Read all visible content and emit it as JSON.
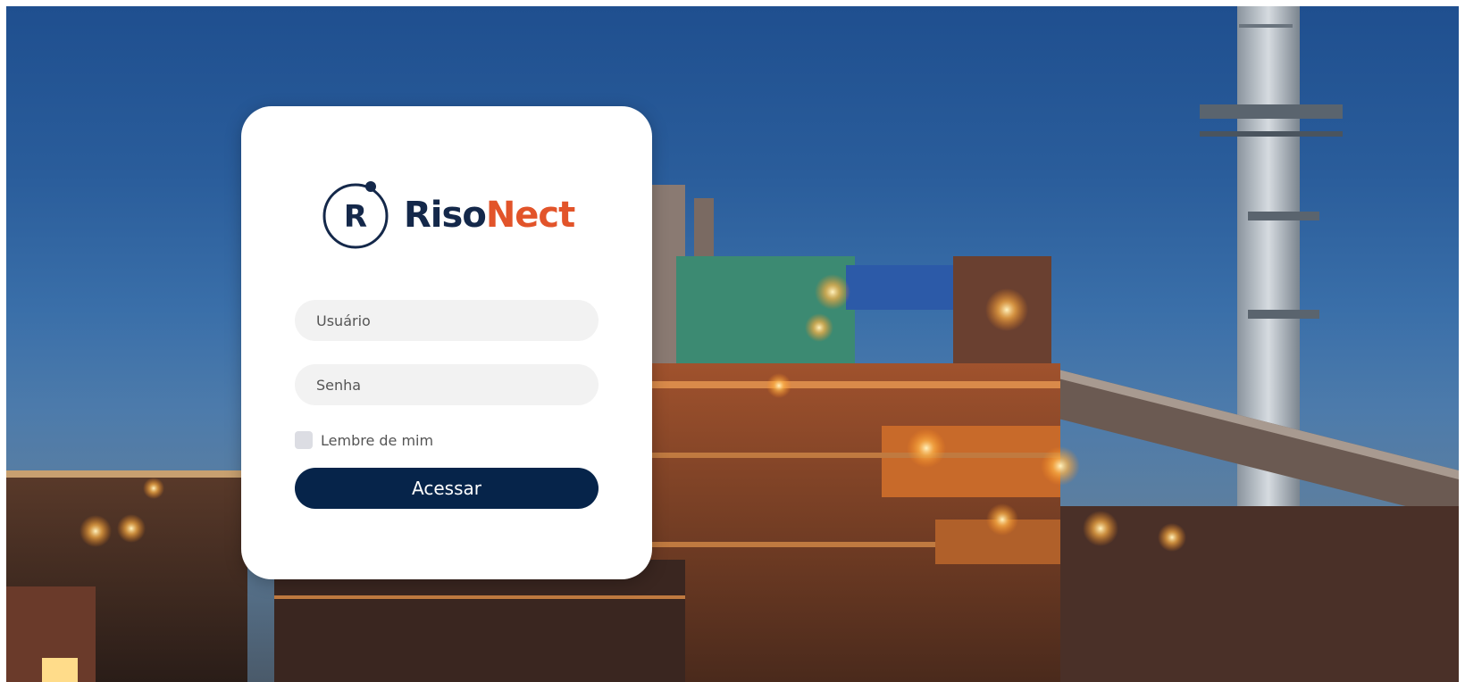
{
  "brand": {
    "mark_letter": "R",
    "name_part1": "Riso",
    "name_part2": "Nect",
    "color_primary": "#14284a",
    "color_accent": "#e2542a"
  },
  "login": {
    "username_placeholder": "Usuário",
    "password_placeholder": "Senha",
    "remember_label": "Lembre de mim",
    "submit_label": "Acessar",
    "button_color": "#06244a"
  },
  "background": {
    "description_icon": "industrial-plant-photo"
  }
}
